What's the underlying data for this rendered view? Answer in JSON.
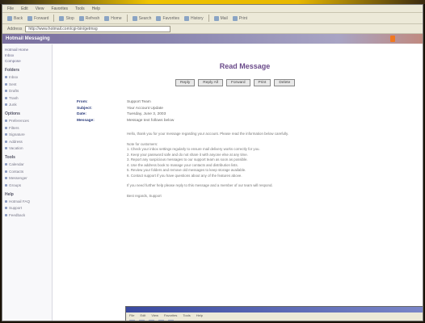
{
  "menubar": [
    "File",
    "Edit",
    "View",
    "Favorites",
    "Tools",
    "Help"
  ],
  "toolbar": [
    "Back",
    "Forward",
    "Stop",
    "Refresh",
    "Home",
    "Search",
    "Favorites",
    "History",
    "Mail",
    "Print"
  ],
  "address": {
    "label": "Address",
    "value": "http://www.hotmail.com/cgi-bin/getmsg"
  },
  "window_title": "Hotmail Messaging",
  "sidebar": {
    "links": [
      "Hotmail Home",
      "Inbox",
      "Compose"
    ],
    "sections": [
      {
        "title": "Folders",
        "items": [
          "Inbox",
          "Sent",
          "Drafts",
          "Trash",
          "Junk"
        ]
      },
      {
        "title": "Options",
        "items": [
          "Preferences",
          "Filters",
          "Signature",
          "Address",
          "Vacation"
        ]
      },
      {
        "title": "Tools",
        "items": [
          "Calendar",
          "Contacts",
          "Messenger",
          "Groups"
        ]
      },
      {
        "title": "Help",
        "items": [
          "Hotmail FAQ",
          "Support",
          "Feedback"
        ]
      }
    ]
  },
  "page_title": "Read Message",
  "buttons": [
    "Reply",
    "Reply All",
    "Forward",
    "Print",
    "Delete"
  ],
  "headers": [
    {
      "k": "From:",
      "v": "Support Team"
    },
    {
      "k": "Subject:",
      "v": "Your Account Update"
    },
    {
      "k": "Date:",
      "v": "Tuesday, June 3, 2003"
    },
    {
      "k": "Message:",
      "v": "Message text follows below"
    }
  ],
  "body": [
    "Hello, thank you for your message regarding your account. Please read the information below carefully.",
    "Note for customers:",
    "1. Check your inbox settings regularly to ensure mail delivery works correctly for you.",
    "2. Keep your password safe and do not share it with anyone else at any time.",
    "3. Report any suspicious messages to our support team as soon as possible.",
    "4. Use the address book to manage your contacts and distribution lists.",
    "5. Review your folders and remove old messages to keep storage available.",
    "6. Contact support if you have questions about any of the features above.",
    "If you need further help please reply to this message and a member of our team will respond.",
    "Best regards, Support"
  ]
}
